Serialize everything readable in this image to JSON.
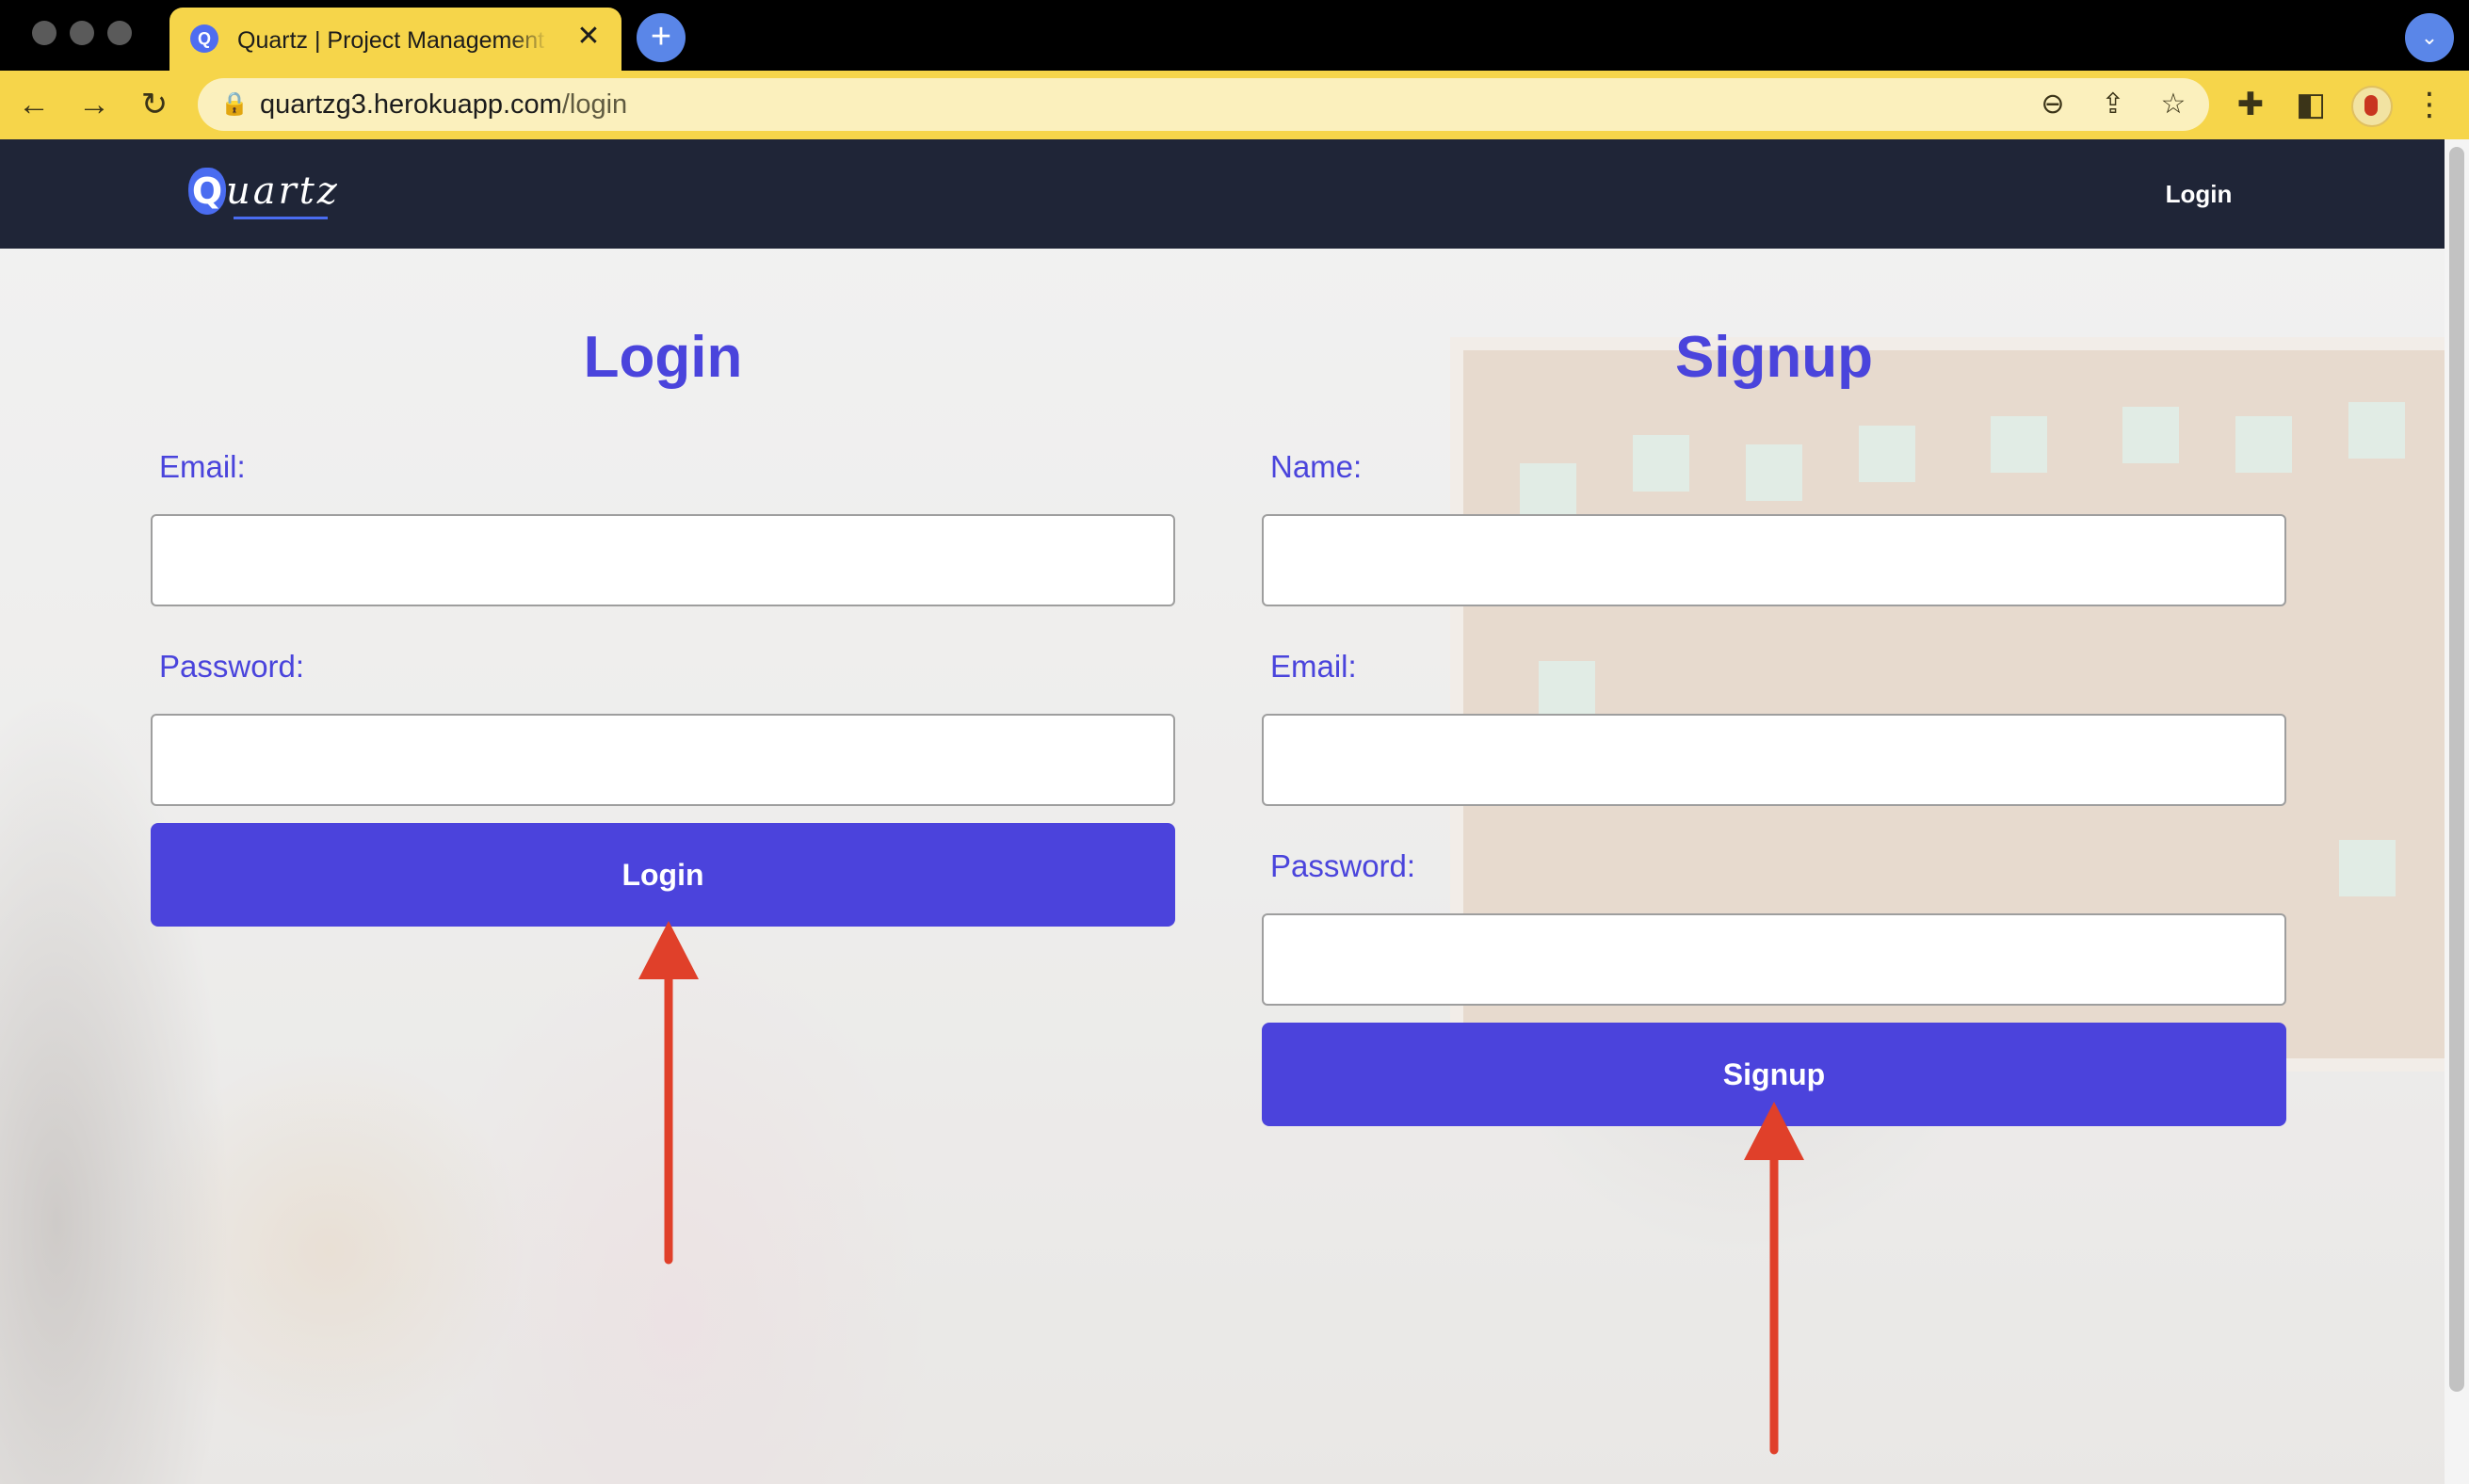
{
  "browser": {
    "tab_title": "Quartz | Project Management Tool",
    "tab_favicon": "Q",
    "tab_close": "✕",
    "new_tab": "+",
    "tab_search": "⌄",
    "url_host": "quartzg3.herokuapp.com",
    "url_path": "/login",
    "icons": {
      "back": "←",
      "forward": "→",
      "reload": "↻",
      "lock": "🔒",
      "zoom": "⊖",
      "share": "⇪",
      "bookmark": "☆",
      "extensions": "✚",
      "sidepanel": "◧",
      "menu": "⋮"
    }
  },
  "navbar": {
    "logo_q": "Q",
    "logo_text": "uartz",
    "login_link": "Login"
  },
  "login": {
    "heading": "Login",
    "email_label": "Email:",
    "password_label": "Password:",
    "button": "Login"
  },
  "signup": {
    "heading": "Signup",
    "name_label": "Name:",
    "email_label": "Email:",
    "password_label": "Password:",
    "button": "Signup"
  },
  "colors": {
    "accent": "#4b43dc",
    "navbar": "#1f2537",
    "browser_chrome": "#f6d54a",
    "annotation_arrow": "#e0402a"
  }
}
